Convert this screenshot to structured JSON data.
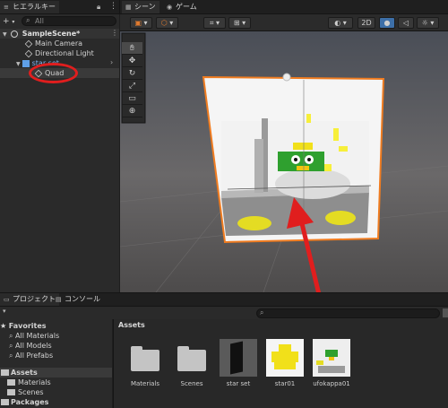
{
  "hierarchy": {
    "tab_label": "ヒエラルキー",
    "search_placeholder": "All",
    "scene_name": "SampleScene*",
    "items": [
      {
        "label": "Main Camera"
      },
      {
        "label": "Directional Light"
      },
      {
        "label": "star set"
      },
      {
        "label": "Quad"
      }
    ]
  },
  "scene_view": {
    "tab_scene": "シーン",
    "tab_game": "ゲーム",
    "mode_2d": "2D"
  },
  "project": {
    "tab_project": "プロジェクト",
    "tab_console": "コンソール",
    "favorites_label": "Favorites",
    "favorites": [
      {
        "label": "All Materials"
      },
      {
        "label": "All Models"
      },
      {
        "label": "All Prefabs"
      }
    ],
    "assets_label": "Assets",
    "asset_folders": [
      {
        "label": "Materials"
      },
      {
        "label": "Scenes"
      }
    ],
    "packages_label": "Packages",
    "breadcrumb": "Assets",
    "assets": [
      {
        "label": "Materials"
      },
      {
        "label": "Scenes"
      },
      {
        "label": "star set"
      },
      {
        "label": "star01"
      },
      {
        "label": "ufokappa01"
      }
    ]
  },
  "colors": {
    "annotation_red": "#e01e1e",
    "selection_orange": "#f07c20",
    "accent_blue": "#3d6fa8"
  }
}
